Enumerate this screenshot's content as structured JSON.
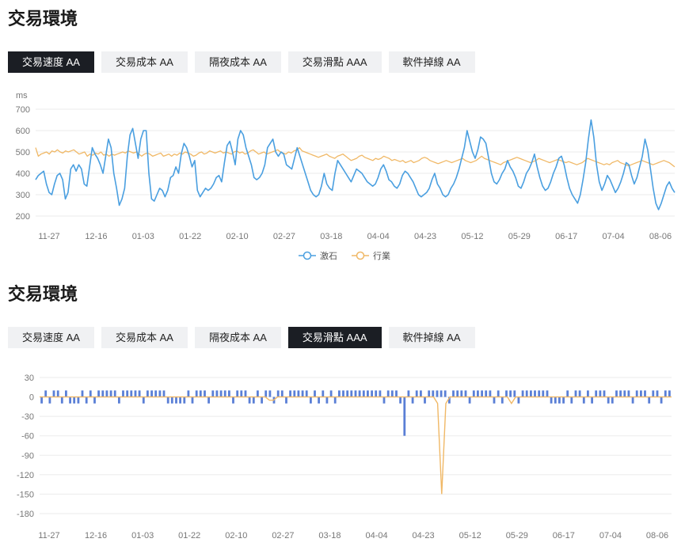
{
  "section1": {
    "title": "交易環境",
    "tabs": [
      {
        "label": "交易速度 AA",
        "active": true
      },
      {
        "label": "交易成本 AA",
        "active": false
      },
      {
        "label": "隔夜成本 AA",
        "active": false
      },
      {
        "label": "交易滑點 AAA",
        "active": false
      },
      {
        "label": "軟件掉線 AA",
        "active": false
      }
    ]
  },
  "section2": {
    "title": "交易環境",
    "tabs": [
      {
        "label": "交易速度 AA",
        "active": false
      },
      {
        "label": "交易成本 AA",
        "active": false
      },
      {
        "label": "隔夜成本 AA",
        "active": false
      },
      {
        "label": "交易滑點 AAA",
        "active": true
      },
      {
        "label": "軟件掉線 AA",
        "active": false
      }
    ]
  },
  "colors": {
    "blue": "#4a9fe0",
    "orange": "#f0b866",
    "bar": "#5a7fd6",
    "grid": "#ebebeb",
    "tab_active": "#1b1e24",
    "tab_inactive": "#f0f1f3"
  },
  "chart_data": [
    {
      "type": "line",
      "ylabel": "ms",
      "ylim": [
        200,
        700
      ],
      "yticks": [
        200,
        300,
        400,
        500,
        600,
        700
      ],
      "xtick_labels": [
        "11-27",
        "12-16",
        "01-03",
        "01-22",
        "02-10",
        "02-27",
        "03-18",
        "04-04",
        "04-23",
        "05-12",
        "05-29",
        "06-17",
        "07-04",
        "08-06"
      ],
      "legend": "bottom",
      "series": [
        {
          "name": "激石",
          "color": "#4a9fe0",
          "values": [
            370,
            390,
            400,
            410,
            350,
            310,
            300,
            350,
            390,
            400,
            370,
            280,
            310,
            420,
            440,
            410,
            440,
            420,
            350,
            340,
            430,
            520,
            490,
            470,
            440,
            400,
            480,
            560,
            520,
            400,
            330,
            250,
            280,
            330,
            480,
            580,
            610,
            540,
            470,
            560,
            600,
            600,
            400,
            280,
            270,
            300,
            330,
            320,
            290,
            320,
            380,
            390,
            430,
            400,
            490,
            540,
            520,
            480,
            430,
            460,
            320,
            290,
            310,
            330,
            320,
            330,
            350,
            380,
            390,
            360,
            450,
            530,
            550,
            500,
            440,
            560,
            600,
            580,
            520,
            480,
            440,
            380,
            370,
            380,
            400,
            440,
            520,
            540,
            560,
            500,
            480,
            500,
            490,
            440,
            430,
            420,
            470,
            520,
            480,
            440,
            400,
            360,
            320,
            300,
            290,
            300,
            340,
            400,
            350,
            330,
            320,
            400,
            460,
            440,
            420,
            400,
            380,
            360,
            390,
            420,
            410,
            400,
            380,
            360,
            350,
            340,
            350,
            380,
            420,
            440,
            410,
            370,
            360,
            340,
            330,
            350,
            390,
            410,
            400,
            380,
            360,
            330,
            300,
            290,
            300,
            310,
            330,
            370,
            400,
            350,
            330,
            300,
            290,
            300,
            330,
            350,
            380,
            420,
            470,
            520,
            600,
            550,
            500,
            470,
            510,
            570,
            560,
            540,
            470,
            400,
            360,
            350,
            370,
            400,
            420,
            460,
            430,
            410,
            380,
            340,
            330,
            360,
            400,
            420,
            450,
            490,
            430,
            380,
            340,
            320,
            330,
            360,
            400,
            430,
            470,
            480,
            440,
            380,
            330,
            300,
            280,
            260,
            300,
            370,
            450,
            560,
            650,
            570,
            440,
            360,
            320,
            350,
            390,
            370,
            340,
            310,
            330,
            360,
            400,
            450,
            440,
            390,
            350,
            380,
            430,
            480,
            560,
            510,
            420,
            330,
            260,
            230,
            260,
            300,
            340,
            360,
            330,
            310
          ]
        },
        {
          "name": "行業",
          "color": "#f0b866",
          "values": [
            520,
            480,
            490,
            495,
            500,
            490,
            505,
            500,
            510,
            500,
            495,
            505,
            500,
            505,
            510,
            500,
            490,
            495,
            500,
            480,
            490,
            485,
            495,
            490,
            500,
            485,
            490,
            480,
            490,
            485,
            490,
            495,
            500,
            495,
            505,
            500,
            495,
            500,
            490,
            480,
            490,
            495,
            490,
            480,
            485,
            490,
            495,
            480,
            485,
            490,
            480,
            490,
            485,
            495,
            490,
            500,
            495,
            490,
            480,
            485,
            495,
            500,
            490,
            495,
            505,
            500,
            495,
            500,
            505,
            495,
            500,
            495,
            490,
            500,
            505,
            495,
            500,
            490,
            495,
            505,
            510,
            500,
            490,
            495,
            500,
            490,
            495,
            500,
            505,
            510,
            500,
            495,
            490,
            500,
            495,
            505,
            510,
            520,
            505,
            500,
            495,
            490,
            485,
            480,
            475,
            480,
            485,
            490,
            480,
            475,
            470,
            480,
            485,
            490,
            480,
            470,
            460,
            465,
            470,
            480,
            485,
            475,
            470,
            465,
            460,
            470,
            465,
            470,
            480,
            475,
            470,
            460,
            465,
            460,
            455,
            460,
            450,
            455,
            460,
            450,
            455,
            460,
            470,
            475,
            470,
            460,
            455,
            450,
            445,
            450,
            455,
            460,
            455,
            450,
            455,
            460,
            465,
            470,
            460,
            455,
            450,
            455,
            460,
            470,
            480,
            470,
            465,
            460,
            455,
            450,
            445,
            440,
            450,
            455,
            460,
            465,
            470,
            475,
            470,
            465,
            460,
            455,
            450,
            455,
            460,
            470,
            465,
            460,
            455,
            450,
            455,
            460,
            465,
            460,
            455,
            450,
            455,
            450,
            445,
            440,
            445,
            450,
            460,
            470,
            465,
            460,
            455,
            450,
            445,
            440,
            445,
            440,
            450,
            455,
            460,
            450,
            445,
            440,
            435,
            440,
            445,
            450,
            455,
            460,
            455,
            450,
            445,
            440,
            445,
            450,
            455,
            460,
            455,
            450,
            440,
            430
          ]
        }
      ]
    },
    {
      "type": "bar",
      "ylim": [
        -180,
        30
      ],
      "yticks": [
        30,
        0,
        -30,
        -60,
        -90,
        -120,
        -150,
        -180
      ],
      "xtick_labels": [
        "11-27",
        "12-16",
        "01-03",
        "01-22",
        "02-10",
        "02-27",
        "03-18",
        "04-04",
        "04-23",
        "05-12",
        "05-29",
        "06-17",
        "07-04",
        "08-06"
      ],
      "series": [
        {
          "name": "",
          "type": "bar",
          "color": "#5a7fd6",
          "values": [
            -10,
            10,
            -10,
            10,
            10,
            -10,
            10,
            -10,
            -10,
            -10,
            10,
            -10,
            10,
            -10,
            10,
            10,
            10,
            10,
            10,
            -10,
            10,
            10,
            10,
            10,
            10,
            -10,
            10,
            10,
            10,
            10,
            10,
            -10,
            -10,
            -10,
            -10,
            -10,
            10,
            -10,
            10,
            10,
            10,
            -10,
            10,
            10,
            10,
            10,
            10,
            -10,
            10,
            10,
            10,
            -10,
            -10,
            10,
            -10,
            10,
            10,
            -10,
            10,
            10,
            -10,
            10,
            10,
            10,
            10,
            10,
            -10,
            10,
            -10,
            10,
            -10,
            10,
            -10,
            10,
            10,
            10,
            10,
            10,
            10,
            10,
            10,
            10,
            10,
            10,
            -10,
            10,
            10,
            10,
            -10,
            -60,
            10,
            -10,
            10,
            10,
            -10,
            10,
            10,
            10,
            10,
            10,
            -10,
            10,
            10,
            10,
            10,
            -10,
            10,
            10,
            10,
            10,
            10,
            -10,
            10,
            -10,
            10,
            10,
            10,
            -10,
            10,
            10,
            10,
            10,
            10,
            10,
            10,
            -10,
            -10,
            -10,
            -10,
            10,
            -10,
            10,
            10,
            -10,
            10,
            -10,
            10,
            10,
            10,
            -10,
            -10,
            10,
            10,
            10,
            10,
            -10,
            10,
            10,
            10,
            -10,
            10,
            10,
            -10,
            10,
            10
          ]
        },
        {
          "name": "",
          "type": "line",
          "color": "#f0b866",
          "values": [
            0,
            0,
            0,
            0,
            0,
            0,
            0,
            0,
            0,
            0,
            0,
            0,
            0,
            0,
            0,
            0,
            0,
            0,
            0,
            0,
            0,
            0,
            0,
            0,
            0,
            0,
            0,
            0,
            0,
            0,
            0,
            0,
            0,
            0,
            0,
            0,
            0,
            0,
            0,
            0,
            0,
            0,
            0,
            0,
            0,
            0,
            0,
            0,
            0,
            0,
            0,
            0,
            0,
            0,
            0,
            0,
            -5,
            -5,
            0,
            0,
            0,
            0,
            0,
            0,
            0,
            0,
            0,
            0,
            0,
            0,
            0,
            0,
            0,
            0,
            0,
            0,
            0,
            0,
            0,
            0,
            0,
            0,
            0,
            0,
            0,
            0,
            0,
            0,
            0,
            0,
            0,
            0,
            0,
            0,
            0,
            0,
            0,
            -10,
            -150,
            -10,
            0,
            0,
            0,
            0,
            0,
            0,
            0,
            0,
            0,
            0,
            0,
            0,
            0,
            0,
            0,
            -10,
            0,
            0,
            0,
            0,
            0,
            0,
            0,
            0,
            0,
            0,
            0,
            0,
            0,
            0,
            0,
            0,
            0,
            0,
            0,
            0,
            0,
            0,
            0,
            0,
            0,
            0,
            0,
            0,
            0,
            0,
            0,
            0,
            0,
            0,
            0,
            0,
            0,
            0,
            0
          ]
        }
      ]
    }
  ]
}
